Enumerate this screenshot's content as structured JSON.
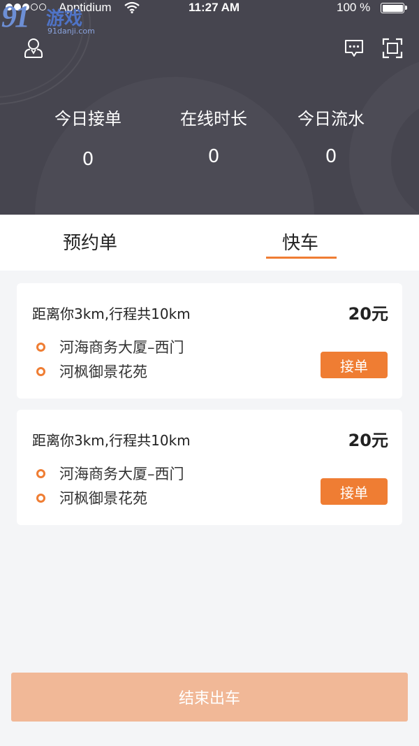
{
  "status_bar": {
    "carrier": "Apptidium",
    "time": "11:27 AM",
    "battery": "100 %"
  },
  "watermark": {
    "logo_number": "91",
    "logo_text": "游戏",
    "url": "91danji.com"
  },
  "header": {
    "icons": [
      "user-icon",
      "message-icon",
      "scan-icon"
    ],
    "stats": [
      {
        "label": "今日接单",
        "value": "0"
      },
      {
        "label": "在线时长",
        "value": "0"
      },
      {
        "label": "今日流水",
        "value": "0"
      }
    ]
  },
  "tabs": [
    {
      "label": "预约单",
      "active": false
    },
    {
      "label": "快车",
      "active": true
    }
  ],
  "orders": [
    {
      "distance": "距离你3km,行程共10km",
      "price": "20元",
      "from": "河海商务大厦–西门",
      "to": "河枫御景花苑",
      "accept_label": "接单"
    },
    {
      "distance": "距离你3km,行程共10km",
      "price": "20元",
      "from": "河海商务大厦–西门",
      "to": "河枫御景花苑",
      "accept_label": "接单"
    }
  ],
  "end_button": "结束出车",
  "colors": {
    "header_bg": "#46454f",
    "accent": "#ef7d33",
    "end_button_bg": "#f1b897",
    "page_bg": "#f4f5f7"
  }
}
